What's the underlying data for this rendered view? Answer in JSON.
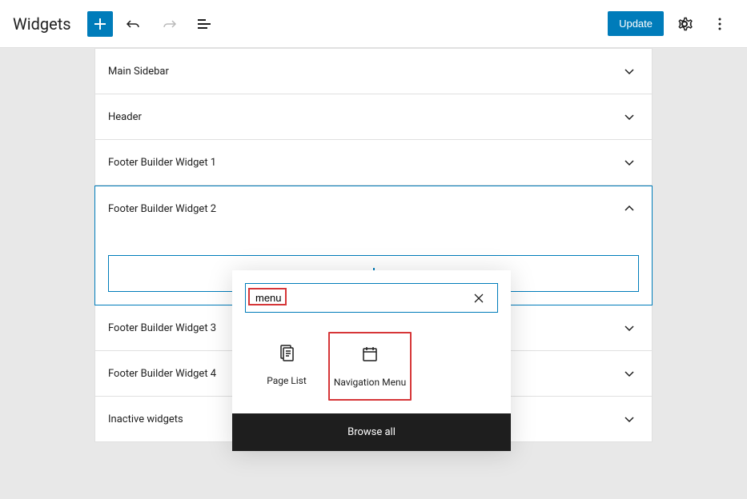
{
  "header": {
    "title": "Widgets",
    "update_label": "Update"
  },
  "areas": [
    {
      "title": "Main Sidebar",
      "expanded": false
    },
    {
      "title": "Header",
      "expanded": false
    },
    {
      "title": "Footer Builder Widget 1",
      "expanded": false
    },
    {
      "title": "Footer Builder Widget 2",
      "expanded": true
    },
    {
      "title": "Footer Builder Widget 3",
      "expanded": false
    },
    {
      "title": "Footer Builder Widget 4",
      "expanded": false
    },
    {
      "title": "Inactive widgets",
      "expanded": false
    }
  ],
  "picker": {
    "search_value": "menu",
    "results": [
      {
        "label": "Page List",
        "icon": "page-list",
        "highlighted": false
      },
      {
        "label": "Navigation Menu",
        "icon": "calendar",
        "highlighted": true
      }
    ],
    "browse_all_label": "Browse all"
  }
}
